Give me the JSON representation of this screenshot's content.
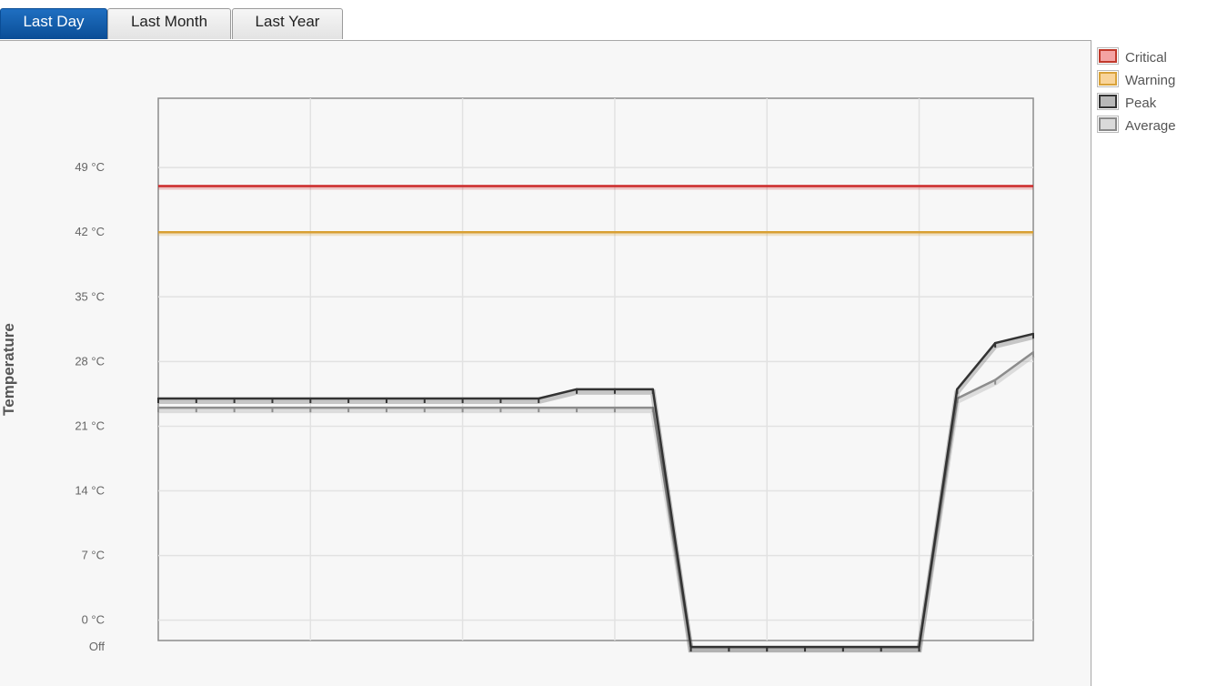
{
  "tabs": [
    {
      "label": "Last Day",
      "active": true
    },
    {
      "label": "Last Month",
      "active": false
    },
    {
      "label": "Last Year",
      "active": false
    }
  ],
  "legend": [
    {
      "label": "Critical",
      "fill": "#f4a3a3",
      "border": "#c0392b"
    },
    {
      "label": "Warning",
      "fill": "#f9d49a",
      "border": "#d8a23a"
    },
    {
      "label": "Peak",
      "fill": "#b8b8b8",
      "border": "#333333"
    },
    {
      "label": "Average",
      "fill": "#dadada",
      "border": "#8a8a8a"
    }
  ],
  "chart_data": {
    "type": "line",
    "ylabel": "Temperature",
    "xlabel": "",
    "ylim": [
      -2.2,
      56.5
    ],
    "y_ticks": [
      {
        "label": "49 °C",
        "value": 49
      },
      {
        "label": "42 °C",
        "value": 42
      },
      {
        "label": "35 °C",
        "value": 35
      },
      {
        "label": "28 °C",
        "value": 28
      },
      {
        "label": "21 °C",
        "value": 21
      },
      {
        "label": "14 °C",
        "value": 14
      },
      {
        "label": "7 °C",
        "value": 7
      },
      {
        "label": "0 °C",
        "value": 0
      },
      {
        "label": "Off",
        "value": -2.9
      }
    ],
    "x_count": 24,
    "thresholds": [
      {
        "name": "Critical",
        "value": 47,
        "color": "#cc2a2a"
      },
      {
        "name": "Warning",
        "value": 42,
        "color": "#d9a033"
      }
    ],
    "series": [
      {
        "name": "Peak",
        "color": "#333333",
        "values": [
          24,
          24,
          24,
          24,
          24,
          24,
          24,
          24,
          24,
          24,
          24,
          25,
          25,
          25,
          -2.9,
          -2.9,
          -2.9,
          -2.9,
          -2.9,
          -2.9,
          -2.9,
          25,
          30,
          31
        ]
      },
      {
        "name": "Average",
        "color": "#8c8c8c",
        "values": [
          23,
          23,
          23,
          23,
          23,
          23,
          23,
          23,
          23,
          23,
          23,
          23,
          23,
          23,
          -2.9,
          -2.9,
          -2.9,
          -2.9,
          -2.9,
          -2.9,
          -2.9,
          24,
          26,
          29
        ]
      }
    ]
  }
}
